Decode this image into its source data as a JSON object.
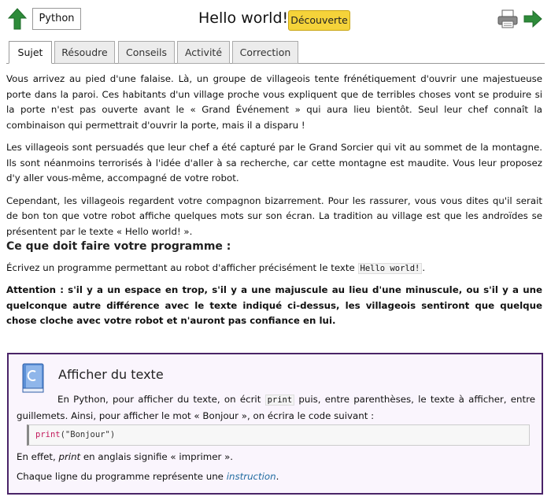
{
  "header": {
    "language_label": "Python",
    "title": "Hello world!",
    "level_badge": "Découverte",
    "colors": {
      "badge": "#f5d33a",
      "arrow": "#2e8b3a",
      "panel_border": "#4a2468"
    }
  },
  "tabs": [
    {
      "label": "Sujet",
      "active": true
    },
    {
      "label": "Résoudre",
      "active": false
    },
    {
      "label": "Conseils",
      "active": false
    },
    {
      "label": "Activité",
      "active": false
    },
    {
      "label": "Correction",
      "active": false
    }
  ],
  "subject": {
    "p1": "Vous arrivez au pied d'une falaise. Là, un groupe de villageois tente frénétiquement d'ouvrir une majestueuse porte dans la paroi. Ces habitants d'un village proche vous expliquent que de terribles choses vont se produire si la porte n'est pas ouverte avant le « Grand Événement » qui aura lieu bientôt. Seul leur chef connaît la combinaison qui permettrait d'ouvrir la porte, mais il a disparu !",
    "p2": "Les villageois sont persuadés que leur chef a été capturé par le Grand Sorcier qui vit au sommet de la montagne. Ils sont néanmoins terrorisés à l'idée d'aller à sa recherche, car cette montagne est maudite. Vous leur proposez d'y aller vous-même, accompagné de votre robot.",
    "p3": "Cependant, les villageois regardent votre compagnon bizarrement. Pour les rassurer, vous vous dites qu'il serait de bon ton que votre robot affiche quelques mots sur son écran. La tradition au village est que les androïdes se présentent par le texte « Hello world! ».",
    "heading": "Ce que doit faire votre programme :",
    "task_before": "Écrivez un programme permettant au robot d'afficher précisément le texte ",
    "task_code": "Hello world!",
    "task_after": ".",
    "warning": "Attention : s'il y a un espace en trop, s'il y a une majuscule au lieu d'une minuscule, ou s'il y a une quelconque autre différence avec le texte indiqué ci-dessus, les villageois sentiront que quelque chose cloche avec votre robot et n'auront pas confiance en lui."
  },
  "panel": {
    "title": "Afficher du texte",
    "intro_before": "En Python, pour afficher du texte, on écrit ",
    "intro_code": "print",
    "intro_after": " puis, entre parenthèses, le texte à afficher, entre guillemets. Ainsi, pour afficher le mot « Bonjour », on écrira le code suivant :",
    "code_keyword": "print",
    "code_rest": "(\"Bonjour\")",
    "note1_before": "En effet, ",
    "note1_italic": "print",
    "note1_after": " en anglais signifie « imprimer ».",
    "note2_before": "Chaque ligne du programme représente une ",
    "note2_link": "instruction",
    "note2_after": "."
  }
}
